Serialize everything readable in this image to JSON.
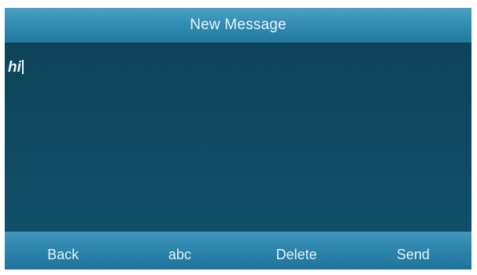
{
  "screen": {
    "title": "New Message"
  },
  "message": {
    "text": "hi"
  },
  "softkeys": [
    {
      "label": "Back"
    },
    {
      "label": "abc"
    },
    {
      "label": "Delete"
    },
    {
      "label": "Send"
    }
  ],
  "colors": {
    "title_bar": "#2f88ae",
    "background": "#0f4a62",
    "softkey_bar": "#2c84ab",
    "text": "#e9f4fa"
  }
}
